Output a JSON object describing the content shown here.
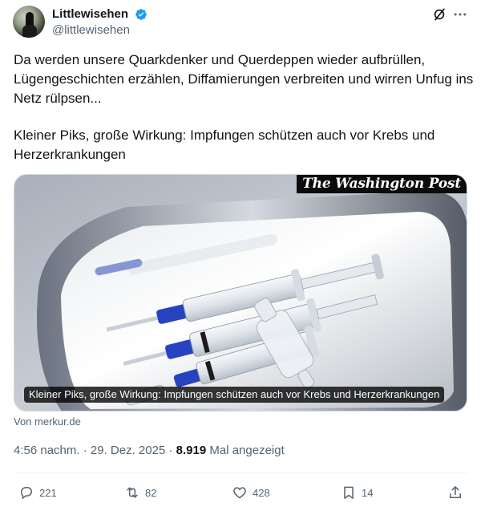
{
  "author": {
    "display_name": "Littlewisehen",
    "handle": "@littlewisehen",
    "verified": true,
    "verified_color": "#1d9bf0"
  },
  "tweet": {
    "paragraph1": "Da werden unsere Quarkdenker und Querdeppen wieder aufbrüllen, Lügengeschichten erzählen, Diffamierungen verbreiten und wirren Unfug ins Netz rülpsen...",
    "paragraph2": "Kleiner Piks, große Wirkung: Impfungen schützen auch vor Krebs und Herzerkrankungen"
  },
  "card": {
    "watermark": "The Washington Post",
    "caption": "Kleiner Piks, große Wirkung: Impfungen schützen auch vor Krebs und Herzerkrankungen",
    "source": "Von merkur.de"
  },
  "meta": {
    "time": "4:56 nachm.",
    "separator": "·",
    "date": "29. Dez. 2025",
    "views_count": "8.919",
    "views_label": "Mal angezeigt"
  },
  "actions": {
    "replies": "221",
    "reposts": "82",
    "likes": "428",
    "bookmarks": "14"
  },
  "icons": [
    "verified-icon",
    "grok-icon",
    "more-icon",
    "reply-icon",
    "repost-icon",
    "like-icon",
    "bookmark-icon",
    "share-icon"
  ]
}
